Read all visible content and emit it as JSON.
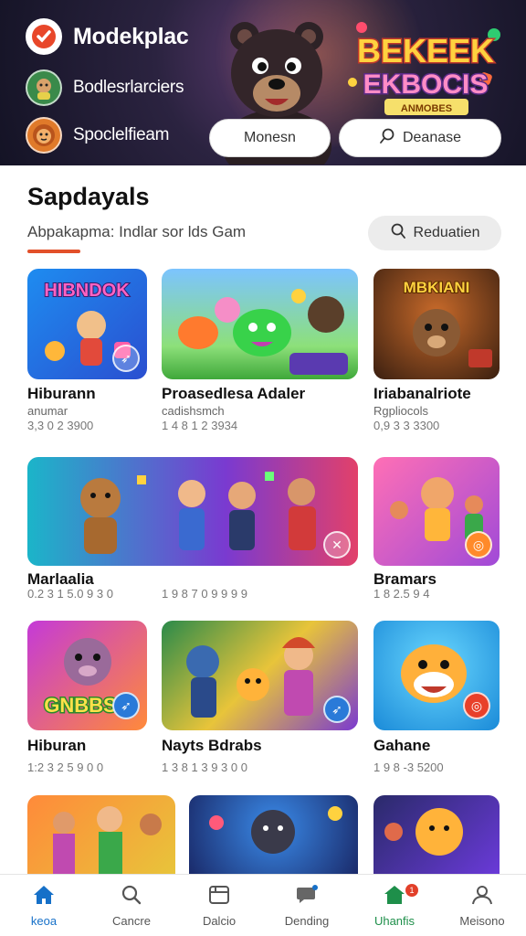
{
  "header": {
    "apps": [
      {
        "label": "Modekplac",
        "icon": "check-badge-icon"
      },
      {
        "label": "Bodlesrlarciers",
        "icon": "character-avatar-icon"
      },
      {
        "label": "Spoclelfieam",
        "icon": "lion-avatar-icon"
      }
    ],
    "banner_text": "BEKEEK EKBOCIS",
    "banner_sub": "ANMOBES",
    "pill_left": "Monesn",
    "pill_right": "Deanase",
    "colors": {
      "accent": "#e2502a",
      "header_bg": "#1b1a30"
    }
  },
  "section": {
    "title": "Sapdayals",
    "subtitle": "Abpakapma: Indlar sor lds Gam",
    "filter_label": "Reduatien"
  },
  "cards": [
    {
      "name": "Hiburann",
      "meta": "anumar",
      "num": "3,3 0 2 3900",
      "art": "HIBNDOK"
    },
    {
      "name": "Proasedlesa Adaler",
      "meta": "cadishsmch",
      "num": "1 4 8 1 2 3934",
      "art": ""
    },
    {
      "name": "Iriabanalriote",
      "meta": "Rgpliocols",
      "num": "0,9 3 3 3300",
      "art": "MBKIANI"
    },
    {
      "name": "Marlaalia",
      "meta": "",
      "num": "0.2 3 1 5.0 9 3 0",
      "art": ""
    },
    {
      "name": "",
      "meta": "",
      "num": "1 9 8 7 0 9 9 9 9",
      "art": ""
    },
    {
      "name": "Bramars",
      "meta": "",
      "num": "1 8 2.5 9 4",
      "art": ""
    },
    {
      "name": "Hiburan",
      "meta": "",
      "num": "1:2 3 2 5 9 0 0",
      "art": "GNBBS"
    },
    {
      "name": "Nayts Bdrabs",
      "meta": "",
      "num": "1 3 8 1 3 9 3 0 0",
      "art": ""
    },
    {
      "name": "Gahane",
      "meta": "",
      "num": "1 9 8 -3 5200",
      "art": ""
    }
  ],
  "nav": [
    {
      "label": "keoa",
      "icon": "home-icon"
    },
    {
      "label": "Cancre",
      "icon": "search-icon"
    },
    {
      "label": "Dalcio",
      "icon": "library-icon"
    },
    {
      "label": "Dending",
      "icon": "chat-icon"
    },
    {
      "label": "Uhanfis",
      "icon": "store-icon",
      "badge": "1"
    },
    {
      "label": "Meisono",
      "icon": "profile-icon"
    }
  ]
}
